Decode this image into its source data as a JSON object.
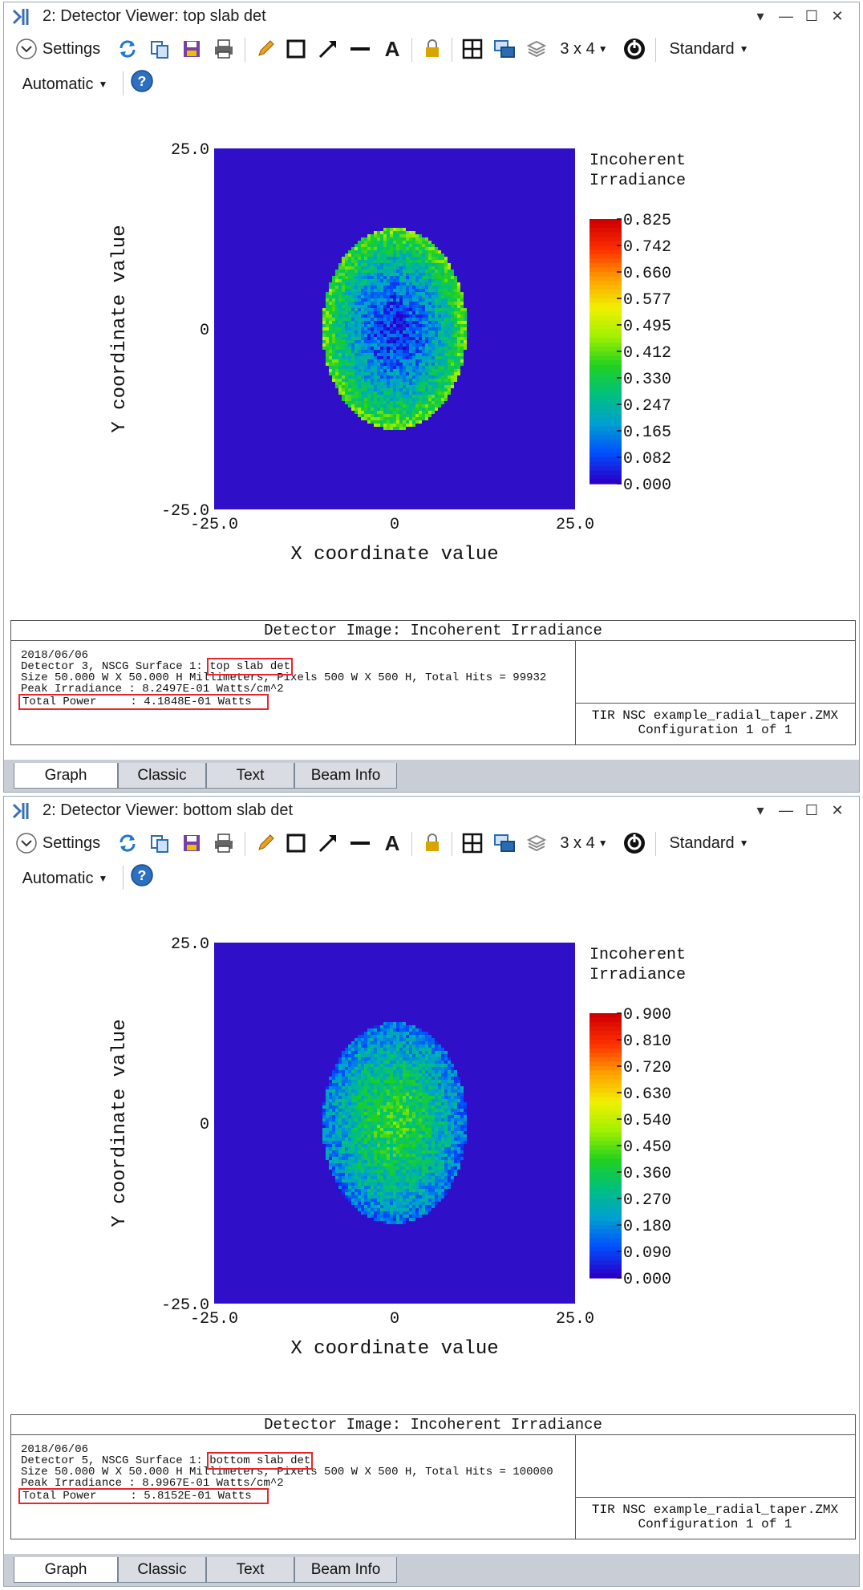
{
  "window1": {
    "title": "2: Detector Viewer: top slab det",
    "toolbar": {
      "settings_label": "Settings",
      "layout_label": "3 x 4",
      "standard_label": "Standard",
      "automatic_label": "Automatic"
    },
    "chart_data": {
      "type": "heatmap",
      "title": "",
      "xlabel": "X coordinate value",
      "ylabel": "Y coordinate value",
      "xlim": [
        -25.0,
        25.0
      ],
      "ylim": [
        -25.0,
        25.0
      ],
      "x_ticks": [
        "-25.0",
        "0",
        "25.0"
      ],
      "y_ticks": [
        "25.0",
        "0",
        "-25.0"
      ],
      "colorbar_title_line1": "Incoherent",
      "colorbar_title_line2": "Irradiance",
      "colorbar_ticks": [
        "0.825",
        "0.742",
        "0.660",
        "0.577",
        "0.495",
        "0.412",
        "0.330",
        "0.247",
        "0.165",
        "0.082",
        "0.000"
      ],
      "spot": {
        "center_x": 0,
        "center_y": 0,
        "radius_x": 10,
        "radius_y": 14,
        "pattern": "ring",
        "edge_level": 0.5,
        "center_level": 0.06
      }
    },
    "info": {
      "title": "Detector Image: Incoherent Irradiance",
      "date": "2018/06/06",
      "detector_prefix": "Detector 3, NSCG Surface 1:",
      "detector_name": "top slab det",
      "size_line": "Size 50.000 W X 50.000 H Millimeters, Pixels 500 W X 500 H, Total Hits = 99932",
      "peak_line": "Peak Irradiance : 8.2497E-01 Watts/cm^2",
      "power_line": "Total Power     : 4.1848E-01 Watts",
      "file_name": "TIR NSC example_radial_taper.ZMX",
      "config": "Configuration 1 of 1"
    },
    "tabs": [
      "Graph",
      "Classic",
      "Text",
      "Beam Info"
    ]
  },
  "window2": {
    "title": "2: Detector Viewer: bottom slab det",
    "toolbar": {
      "settings_label": "Settings",
      "layout_label": "3 x 4",
      "standard_label": "Standard",
      "automatic_label": "Automatic"
    },
    "chart_data": {
      "type": "heatmap",
      "title": "",
      "xlabel": "X coordinate value",
      "ylabel": "Y coordinate value",
      "xlim": [
        -25.0,
        25.0
      ],
      "ylim": [
        -25.0,
        25.0
      ],
      "x_ticks": [
        "-25.0",
        "0",
        "25.0"
      ],
      "y_ticks": [
        "25.0",
        "0",
        "-25.0"
      ],
      "colorbar_title_line1": "Incoherent",
      "colorbar_title_line2": "Irradiance",
      "colorbar_ticks": [
        "0.900",
        "0.810",
        "0.720",
        "0.630",
        "0.540",
        "0.450",
        "0.360",
        "0.270",
        "0.180",
        "0.090",
        "0.000"
      ],
      "spot": {
        "center_x": 0,
        "center_y": 0,
        "radius_x": 10,
        "radius_y": 14,
        "pattern": "center",
        "edge_level": 0.15,
        "center_level": 0.45
      }
    },
    "info": {
      "title": "Detector Image: Incoherent Irradiance",
      "date": "2018/06/06",
      "detector_prefix": "Detector 5, NSCG Surface 1:",
      "detector_name": "bottom slab det",
      "size_line": "Size 50.000 W X 50.000 H Millimeters, Pixels 500 W X 500 H, Total Hits = 100000",
      "peak_line": "Peak Irradiance : 8.9967E-01 Watts/cm^2",
      "power_line": "Total Power     : 5.8152E-01 Watts",
      "file_name": "TIR NSC example_radial_taper.ZMX",
      "config": "Configuration 1 of 1"
    },
    "tabs": [
      "Graph",
      "Classic",
      "Text",
      "Beam Info"
    ]
  },
  "colors": {
    "background_level": "#2f10c8",
    "colormap": [
      "#2a00c8",
      "#0050ff",
      "#00a0d0",
      "#00c080",
      "#20d020",
      "#a0f000",
      "#f0f000",
      "#ffa000",
      "#ff3000",
      "#d00000"
    ]
  }
}
